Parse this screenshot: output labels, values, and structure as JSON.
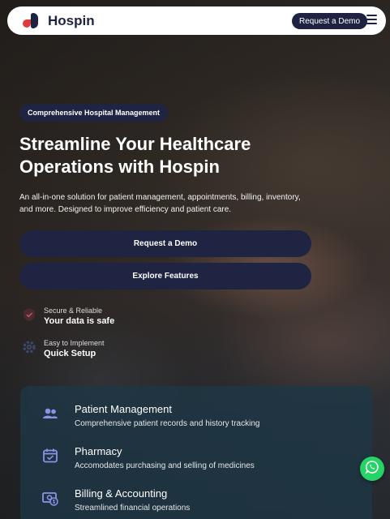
{
  "header": {
    "brand": "Hospin",
    "cta_label": "Request a Demo",
    "menu_icon": "hamburger-menu-icon"
  },
  "hero": {
    "badge": "Comprehensive Hospital Management",
    "title": "Streamline Your Healthcare Operations with Hospin",
    "subtitle": "An all-in-one solution for patient management, appointments, billing, inventory, and more. Designed to improve efficiency and patient care.",
    "primary_button": "Request a Demo",
    "secondary_button": "Explore Features"
  },
  "features": [
    {
      "icon": "shield-icon",
      "small": "Secure & Reliable",
      "big": "Your data is safe"
    },
    {
      "icon": "gear-icon",
      "small": "Easy to Implement",
      "big": "Quick Setup"
    }
  ],
  "services": [
    {
      "icon": "users-icon",
      "title": "Patient Management",
      "desc": "Comprehensive patient records and history tracking"
    },
    {
      "icon": "calendar-check-icon",
      "title": "Pharmacy",
      "desc": "Accomodates purchasing and selling of medicines"
    },
    {
      "icon": "money-icon",
      "title": "Billing & Accounting",
      "desc": "Streamlined financial operations"
    }
  ],
  "colors": {
    "brand_navy": "#1d2340",
    "logo_red": "#e03a3a",
    "accent_purple": "#7d86e0",
    "whatsapp_green": "#25d366"
  }
}
